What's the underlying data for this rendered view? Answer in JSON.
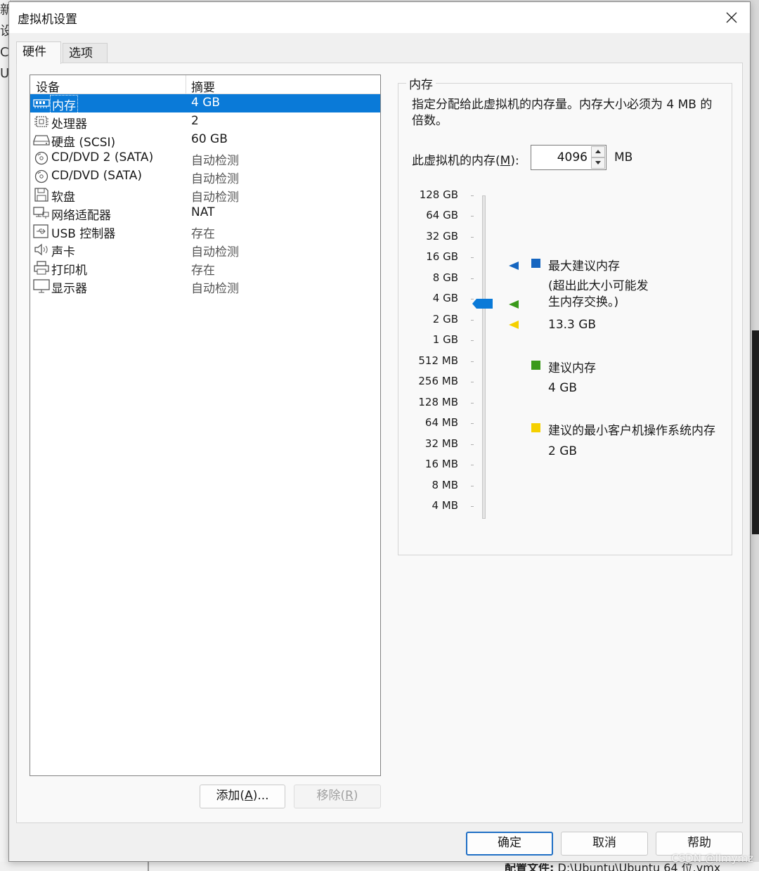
{
  "window": {
    "title": "虚拟机设置"
  },
  "tabs": [
    {
      "label": "硬件"
    },
    {
      "label": "选项"
    }
  ],
  "device_list": {
    "headers": {
      "device": "设备",
      "summary": "摘要"
    },
    "rows": [
      {
        "icon": "memory-icon",
        "name": "内存",
        "summary": "4 GB",
        "selected": true
      },
      {
        "icon": "processor-icon",
        "name": "处理器",
        "summary": "2"
      },
      {
        "icon": "hard-disk-icon",
        "name": "硬盘 (SCSI)",
        "summary": "60 GB"
      },
      {
        "icon": "cd-dvd-icon",
        "name": "CD/DVD 2 (SATA)",
        "summary": "自动检测"
      },
      {
        "icon": "cd-dvd-icon",
        "name": "CD/DVD (SATA)",
        "summary": "自动检测"
      },
      {
        "icon": "floppy-icon",
        "name": "软盘",
        "summary": "自动检测"
      },
      {
        "icon": "network-adapter-icon",
        "name": "网络适配器",
        "summary": "NAT"
      },
      {
        "icon": "usb-icon",
        "name": "USB 控制器",
        "summary": "存在"
      },
      {
        "icon": "sound-card-icon",
        "name": "声卡",
        "summary": "自动检测"
      },
      {
        "icon": "printer-icon",
        "name": "打印机",
        "summary": "存在"
      },
      {
        "icon": "display-icon",
        "name": "显示器",
        "summary": "自动检测"
      }
    ],
    "add_button": {
      "text": "添加(",
      "key": "A",
      "tail": ")..."
    },
    "remove_button": {
      "text": "移除(",
      "key": "R",
      "tail": ")"
    }
  },
  "memory": {
    "group_title": "内存",
    "description": "指定分配给此虚拟机的内存量。内存大小必须为 4 MB 的倍数。",
    "field_label": {
      "text": "此虚拟机的内存(",
      "key": "M",
      "tail": "):"
    },
    "value": "4096",
    "unit": "MB",
    "scale_ticks": [
      "128 GB",
      "64 GB",
      "32 GB",
      "16 GB",
      "8 GB",
      "4 GB",
      "2 GB",
      "1 GB",
      "512 MB",
      "256 MB",
      "128 MB",
      "64 MB",
      "32 MB",
      "16 MB",
      "8 MB",
      "4 MB"
    ],
    "current_level": "4 GB",
    "legend": {
      "max": {
        "label": "最大建议内存",
        "note": "(超出此大小可能发生内存交换。)",
        "value": "13.3 GB",
        "level": "16 GB",
        "color": "#1565c0"
      },
      "recommended": {
        "label": "建议内存",
        "value": "4 GB",
        "level": "4 GB",
        "color": "#3a9a1a"
      },
      "min_guest": {
        "label": "建议的最小客户机操作系统内存",
        "value": "2 GB",
        "level": "2 GB",
        "color": "#f5d000"
      }
    }
  },
  "footer_buttons": {
    "ok": "确定",
    "cancel": "取消",
    "help": "帮助"
  },
  "colors": {
    "selection": "#0a7ad8",
    "slider_thumb": "#0a7ad8"
  },
  "background": {
    "left_text": [
      "新",
      "设",
      "Ce",
      "Ul"
    ],
    "bottom_label": "配置文件:",
    "bottom_path": "D:\\Ubuntu\\Ubuntu 64 位.vmx",
    "watermark": "CSDN @llmymz"
  }
}
